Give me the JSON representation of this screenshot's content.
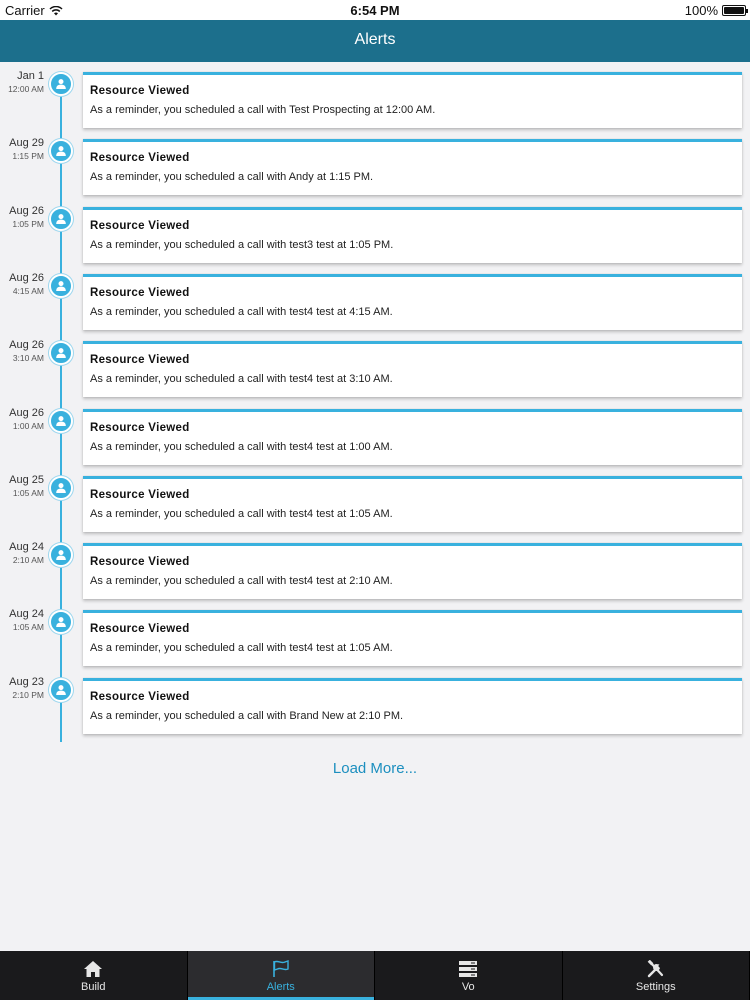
{
  "status_bar": {
    "carrier": "Carrier",
    "time": "6:54 PM",
    "battery": "100%"
  },
  "nav": {
    "title": "Alerts"
  },
  "alerts": [
    {
      "date": "Jan 1",
      "time": "12:00 AM",
      "title": "Resource Viewed",
      "message": "As a reminder, you scheduled a call with Test Prospecting at 12:00 AM."
    },
    {
      "date": "Aug 29",
      "time": "1:15 PM",
      "title": "Resource Viewed",
      "message": "As a reminder, you scheduled a call with Andy at 1:15 PM."
    },
    {
      "date": "Aug 26",
      "time": "1:05 PM",
      "title": "Resource Viewed",
      "message": "As a reminder, you scheduled a call with test3 test at 1:05 PM."
    },
    {
      "date": "Aug 26",
      "time": "4:15 AM",
      "title": "Resource Viewed",
      "message": "As a reminder, you scheduled a call with test4 test at 4:15 AM."
    },
    {
      "date": "Aug 26",
      "time": "3:10 AM",
      "title": "Resource Viewed",
      "message": "As a reminder, you scheduled a call with test4 test at 3:10 AM."
    },
    {
      "date": "Aug 26",
      "time": "1:00 AM",
      "title": "Resource Viewed",
      "message": "As a reminder, you scheduled a call with test4 test at 1:00 AM."
    },
    {
      "date": "Aug 25",
      "time": "1:05 AM",
      "title": "Resource Viewed",
      "message": "As a reminder, you scheduled a call with test4 test at 1:05 AM."
    },
    {
      "date": "Aug 24",
      "time": "2:10 AM",
      "title": "Resource Viewed",
      "message": "As a reminder, you scheduled a call with test4 test at 2:10 AM."
    },
    {
      "date": "Aug 24",
      "time": "1:05 AM",
      "title": "Resource Viewed",
      "message": "As a reminder, you scheduled a call with test4 test at 1:05 AM."
    },
    {
      "date": "Aug 23",
      "time": "2:10 PM",
      "title": "Resource Viewed",
      "message": "As a reminder, you scheduled a call with Brand New at 2:10 PM."
    }
  ],
  "load_more": "Load More...",
  "tabs": [
    {
      "label": "Build",
      "icon": "home-icon",
      "active": false
    },
    {
      "label": "Alerts",
      "icon": "flag-icon",
      "active": true
    },
    {
      "label": "Vo",
      "icon": "server-stack-icon",
      "active": false
    },
    {
      "label": "Settings",
      "icon": "tools-icon",
      "active": false
    }
  ],
  "colors": {
    "accent": "#39b1de",
    "nav_bg": "#1c6f8c",
    "tab_bg": "#1a1a1c",
    "link": "#1c8fbf"
  }
}
